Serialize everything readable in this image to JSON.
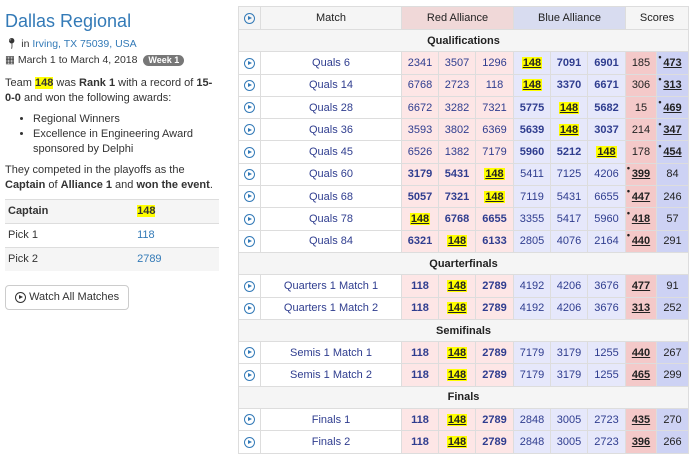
{
  "event": {
    "title": "Dallas Regional",
    "location_prefix": "in",
    "location": "Irving, TX 75039, USA",
    "dates": "March 1 to March 4, 2018",
    "week_badge": "Week 1"
  },
  "summary": {
    "p1_a": "Team ",
    "team": "148",
    "p1_b": " was ",
    "rank": "Rank 1",
    "p1_c": " with a record of ",
    "record": "15-0-0",
    "p1_d": " and won the following awards:",
    "awards": [
      "Regional Winners",
      "Excellence in Engineering Award sponsored by Delphi"
    ],
    "p2_a": "They competed in the playoffs as the ",
    "captain": "Captain",
    "p2_b": " of ",
    "alliance": "Alliance 1",
    "p2_c": " and ",
    "won": "won the event",
    "p2_d": "."
  },
  "alliance_roles": [
    {
      "role": "Captain",
      "team": "148"
    },
    {
      "role": "Pick 1",
      "team": "118"
    },
    {
      "role": "Pick 2",
      "team": "2789"
    }
  ],
  "watch_button": "Watch All Matches",
  "table": {
    "headers": {
      "match": "Match",
      "red": "Red Alliance",
      "blue": "Blue Alliance",
      "scores": "Scores"
    },
    "sections": [
      {
        "title": "Qualifications",
        "matches": [
          {
            "name": "Quals 6",
            "red": [
              "2341",
              "3507",
              "1296"
            ],
            "blue": [
              "148",
              "7091",
              "6901"
            ],
            "red_score": "185",
            "blue_score": "473",
            "winner": "blue",
            "dot": "blue"
          },
          {
            "name": "Quals 14",
            "red": [
              "6768",
              "2723",
              "118"
            ],
            "blue": [
              "148",
              "3370",
              "6671"
            ],
            "red_score": "306",
            "blue_score": "313",
            "winner": "blue",
            "dot": "blue"
          },
          {
            "name": "Quals 28",
            "red": [
              "6672",
              "3282",
              "7321"
            ],
            "blue": [
              "5775",
              "148",
              "5682"
            ],
            "red_score": "15",
            "blue_score": "469",
            "winner": "blue",
            "dot": "blue"
          },
          {
            "name": "Quals 36",
            "red": [
              "3593",
              "3802",
              "6369"
            ],
            "blue": [
              "5639",
              "148",
              "3037"
            ],
            "red_score": "214",
            "blue_score": "347",
            "winner": "blue",
            "dot": "blue"
          },
          {
            "name": "Quals 45",
            "red": [
              "6526",
              "1382",
              "7179"
            ],
            "blue": [
              "5960",
              "5212",
              "148"
            ],
            "red_score": "178",
            "blue_score": "454",
            "winner": "blue",
            "dot": "blue"
          },
          {
            "name": "Quals 60",
            "red": [
              "3179",
              "5431",
              "148"
            ],
            "blue": [
              "5411",
              "7125",
              "4206"
            ],
            "red_score": "399",
            "blue_score": "84",
            "winner": "red",
            "dot": "red"
          },
          {
            "name": "Quals 68",
            "red": [
              "5057",
              "7321",
              "148"
            ],
            "blue": [
              "7119",
              "5431",
              "6655"
            ],
            "red_score": "447",
            "blue_score": "246",
            "winner": "red",
            "dot": "red"
          },
          {
            "name": "Quals 78",
            "red": [
              "148",
              "6768",
              "6655"
            ],
            "blue": [
              "3355",
              "5417",
              "5960"
            ],
            "red_score": "418",
            "blue_score": "57",
            "winner": "red",
            "dot": "red"
          },
          {
            "name": "Quals 84",
            "red": [
              "6321",
              "148",
              "6133"
            ],
            "blue": [
              "2805",
              "4076",
              "2164"
            ],
            "red_score": "440",
            "blue_score": "291",
            "winner": "red",
            "dot": "red"
          }
        ]
      },
      {
        "title": "Quarterfinals",
        "matches": [
          {
            "name": "Quarters 1 Match 1",
            "red": [
              "118",
              "148",
              "2789"
            ],
            "blue": [
              "4192",
              "4206",
              "3676"
            ],
            "red_score": "477",
            "blue_score": "91",
            "winner": "red",
            "dot": ""
          },
          {
            "name": "Quarters 1 Match 2",
            "red": [
              "118",
              "148",
              "2789"
            ],
            "blue": [
              "4192",
              "4206",
              "3676"
            ],
            "red_score": "313",
            "blue_score": "252",
            "winner": "red",
            "dot": ""
          }
        ]
      },
      {
        "title": "Semifinals",
        "matches": [
          {
            "name": "Semis 1 Match 1",
            "red": [
              "118",
              "148",
              "2789"
            ],
            "blue": [
              "7179",
              "3179",
              "1255"
            ],
            "red_score": "440",
            "blue_score": "267",
            "winner": "red",
            "dot": ""
          },
          {
            "name": "Semis 1 Match 2",
            "red": [
              "118",
              "148",
              "2789"
            ],
            "blue": [
              "7179",
              "3179",
              "1255"
            ],
            "red_score": "465",
            "blue_score": "299",
            "winner": "red",
            "dot": ""
          }
        ]
      },
      {
        "title": "Finals",
        "matches": [
          {
            "name": "Finals 1",
            "red": [
              "118",
              "148",
              "2789"
            ],
            "blue": [
              "2848",
              "3005",
              "2723"
            ],
            "red_score": "435",
            "blue_score": "270",
            "winner": "red",
            "dot": ""
          },
          {
            "name": "Finals 2",
            "red": [
              "118",
              "148",
              "2789"
            ],
            "blue": [
              "2848",
              "3005",
              "2723"
            ],
            "red_score": "396",
            "blue_score": "266",
            "winner": "red",
            "dot": ""
          }
        ]
      }
    ]
  }
}
